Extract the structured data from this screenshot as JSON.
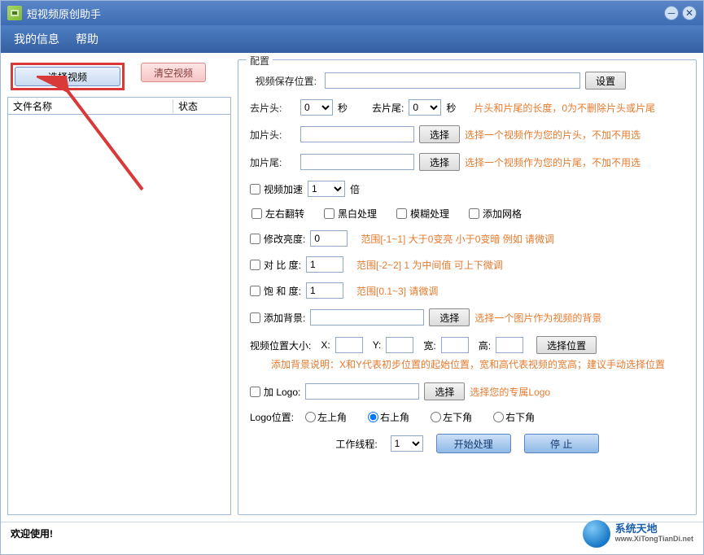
{
  "titlebar": {
    "title": "短视频原创助手"
  },
  "menu": {
    "my_info": "我的信息",
    "help": "帮助"
  },
  "left": {
    "select_video": "选择视频",
    "clear_video": "清空视频",
    "col_filename": "文件名称",
    "col_status": "状态"
  },
  "config": {
    "legend": "配置",
    "save_path_label": "视频保存位置:",
    "save_path_value": "",
    "set_button": "设置",
    "trim_head_label": "去片头:",
    "trim_head_value": "0",
    "seconds1": "秒",
    "trim_tail_label": "去片尾:",
    "trim_tail_value": "0",
    "seconds2": "秒",
    "trim_hint": "片头和片尾的长度，0为不删除片头或片尾",
    "add_head_label": "加片头:",
    "add_head_value": "",
    "choose1": "选择",
    "add_head_hint": "选择一个视频作为您的片头，不加不用选",
    "add_tail_label": "加片尾:",
    "add_tail_value": "",
    "choose2": "选择",
    "add_tail_hint": "选择一个视频作为您的片尾，不加不用选",
    "speed_label": "视频加速",
    "speed_value": "1",
    "speed_suffix": "倍",
    "flip_label": "左右翻转",
    "bw_label": "黑白处理",
    "blur_label": "模糊处理",
    "grid_label": "添加网格",
    "brightness_label": "修改亮度:",
    "brightness_value": "0",
    "brightness_hint": "范围[-1~1]   大于0变亮 小于0变暗  例如 请微调",
    "contrast_label": "对 比  度:",
    "contrast_value": "1",
    "contrast_hint": "范围[-2~2]  1 为中间值  可上下微调",
    "saturation_label": "饱 和  度:",
    "saturation_value": "1",
    "saturation_hint": "范围[0.1~3]   请微调",
    "bg_label": "添加背景:",
    "bg_value": "",
    "choose3": "选择",
    "bg_hint": "选择一个图片作为视频的背景",
    "pos_label": "视频位置大小:",
    "pos_x_label": "X:",
    "pos_x_value": "",
    "pos_y_label": "Y:",
    "pos_y_value": "",
    "pos_w_label": "宽:",
    "pos_w_value": "",
    "pos_h_label": "高:",
    "pos_h_value": "",
    "choose_pos": "选择位置",
    "bg_note": "添加背景说明：X和Y代表初步位置的起始位置，宽和高代表视频的宽高；建议手动选择位置",
    "logo_label": "加 Logo:",
    "logo_value": "",
    "choose4": "选择",
    "logo_hint": "选择您的专属Logo",
    "logo_pos_label": "Logo位置:",
    "logo_pos_tl": "左上角",
    "logo_pos_tr": "右上角",
    "logo_pos_bl": "左下角",
    "logo_pos_br": "右下角",
    "threads_label": "工作线程:",
    "threads_value": "1",
    "start_button": "开始处理",
    "stop_button": "停    止"
  },
  "statusbar": {
    "welcome": "欢迎使用!"
  },
  "brand": {
    "name": "系统天地",
    "url": "www.XiTongTianDi.net"
  }
}
